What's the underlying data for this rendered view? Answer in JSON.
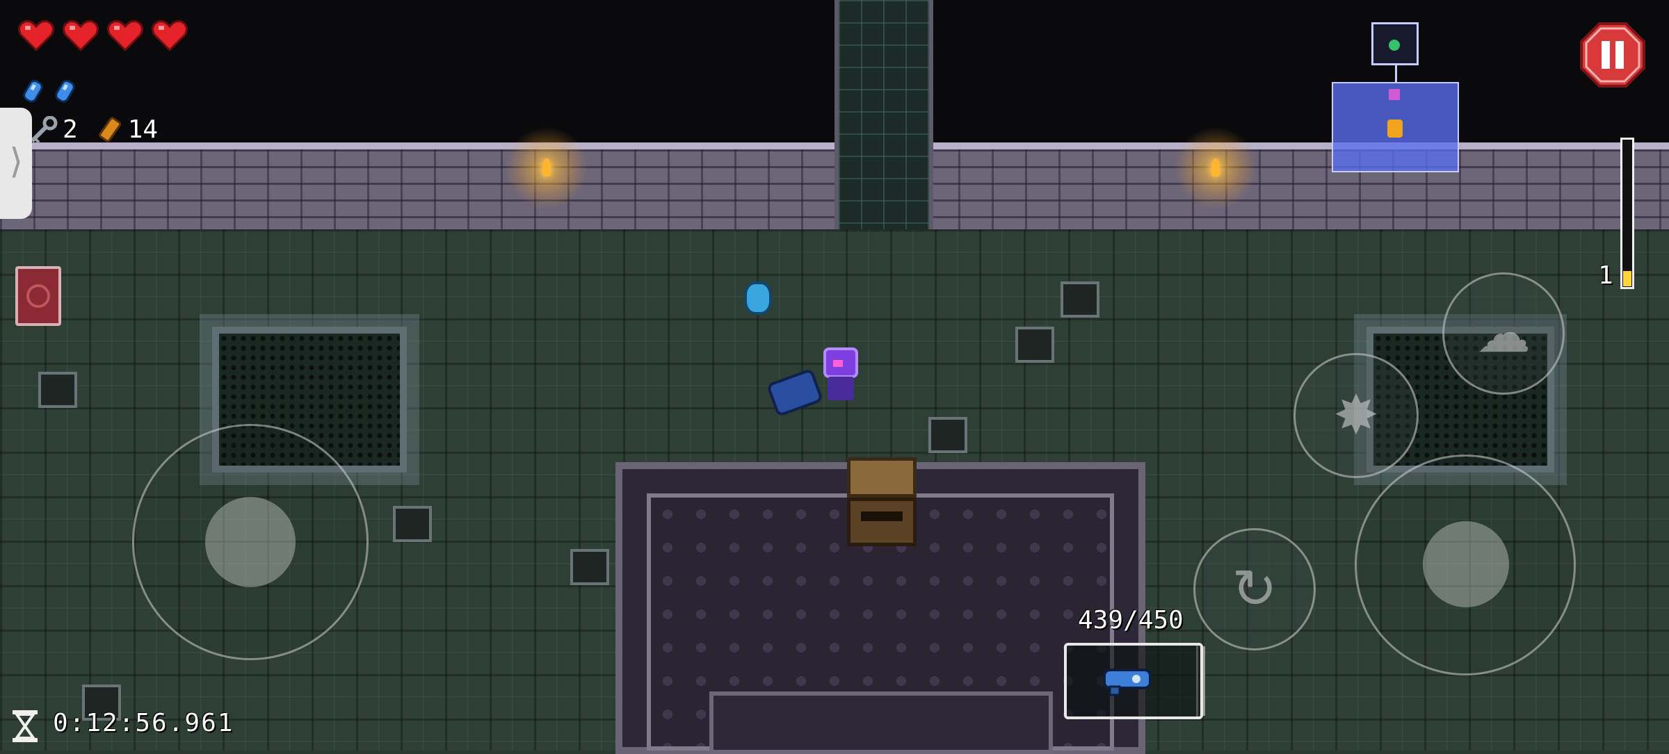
{
  "hud": {
    "hearts": {
      "full": 4,
      "max": 4
    },
    "blanks_count": 2,
    "keys": "2",
    "casings": "14",
    "timer": "0:12:56.961",
    "ammo": "439/450",
    "blank_meter_count": "1"
  },
  "controls": {
    "side_drawer": "chevron-right-icon",
    "pause": "pause-icon",
    "active_item": "red-book-icon",
    "dodge_roll_button": "dodge-roll-icon",
    "reload_button": "reload-icon",
    "blank_button": "blank-icon",
    "equipped_gun": "blue-gun-icon"
  },
  "colors": {
    "heart": "#e3222a",
    "pause_button": "#d8393b",
    "minimap": "#5a6ef0",
    "blank_meter_fill": "#ffd43b"
  }
}
